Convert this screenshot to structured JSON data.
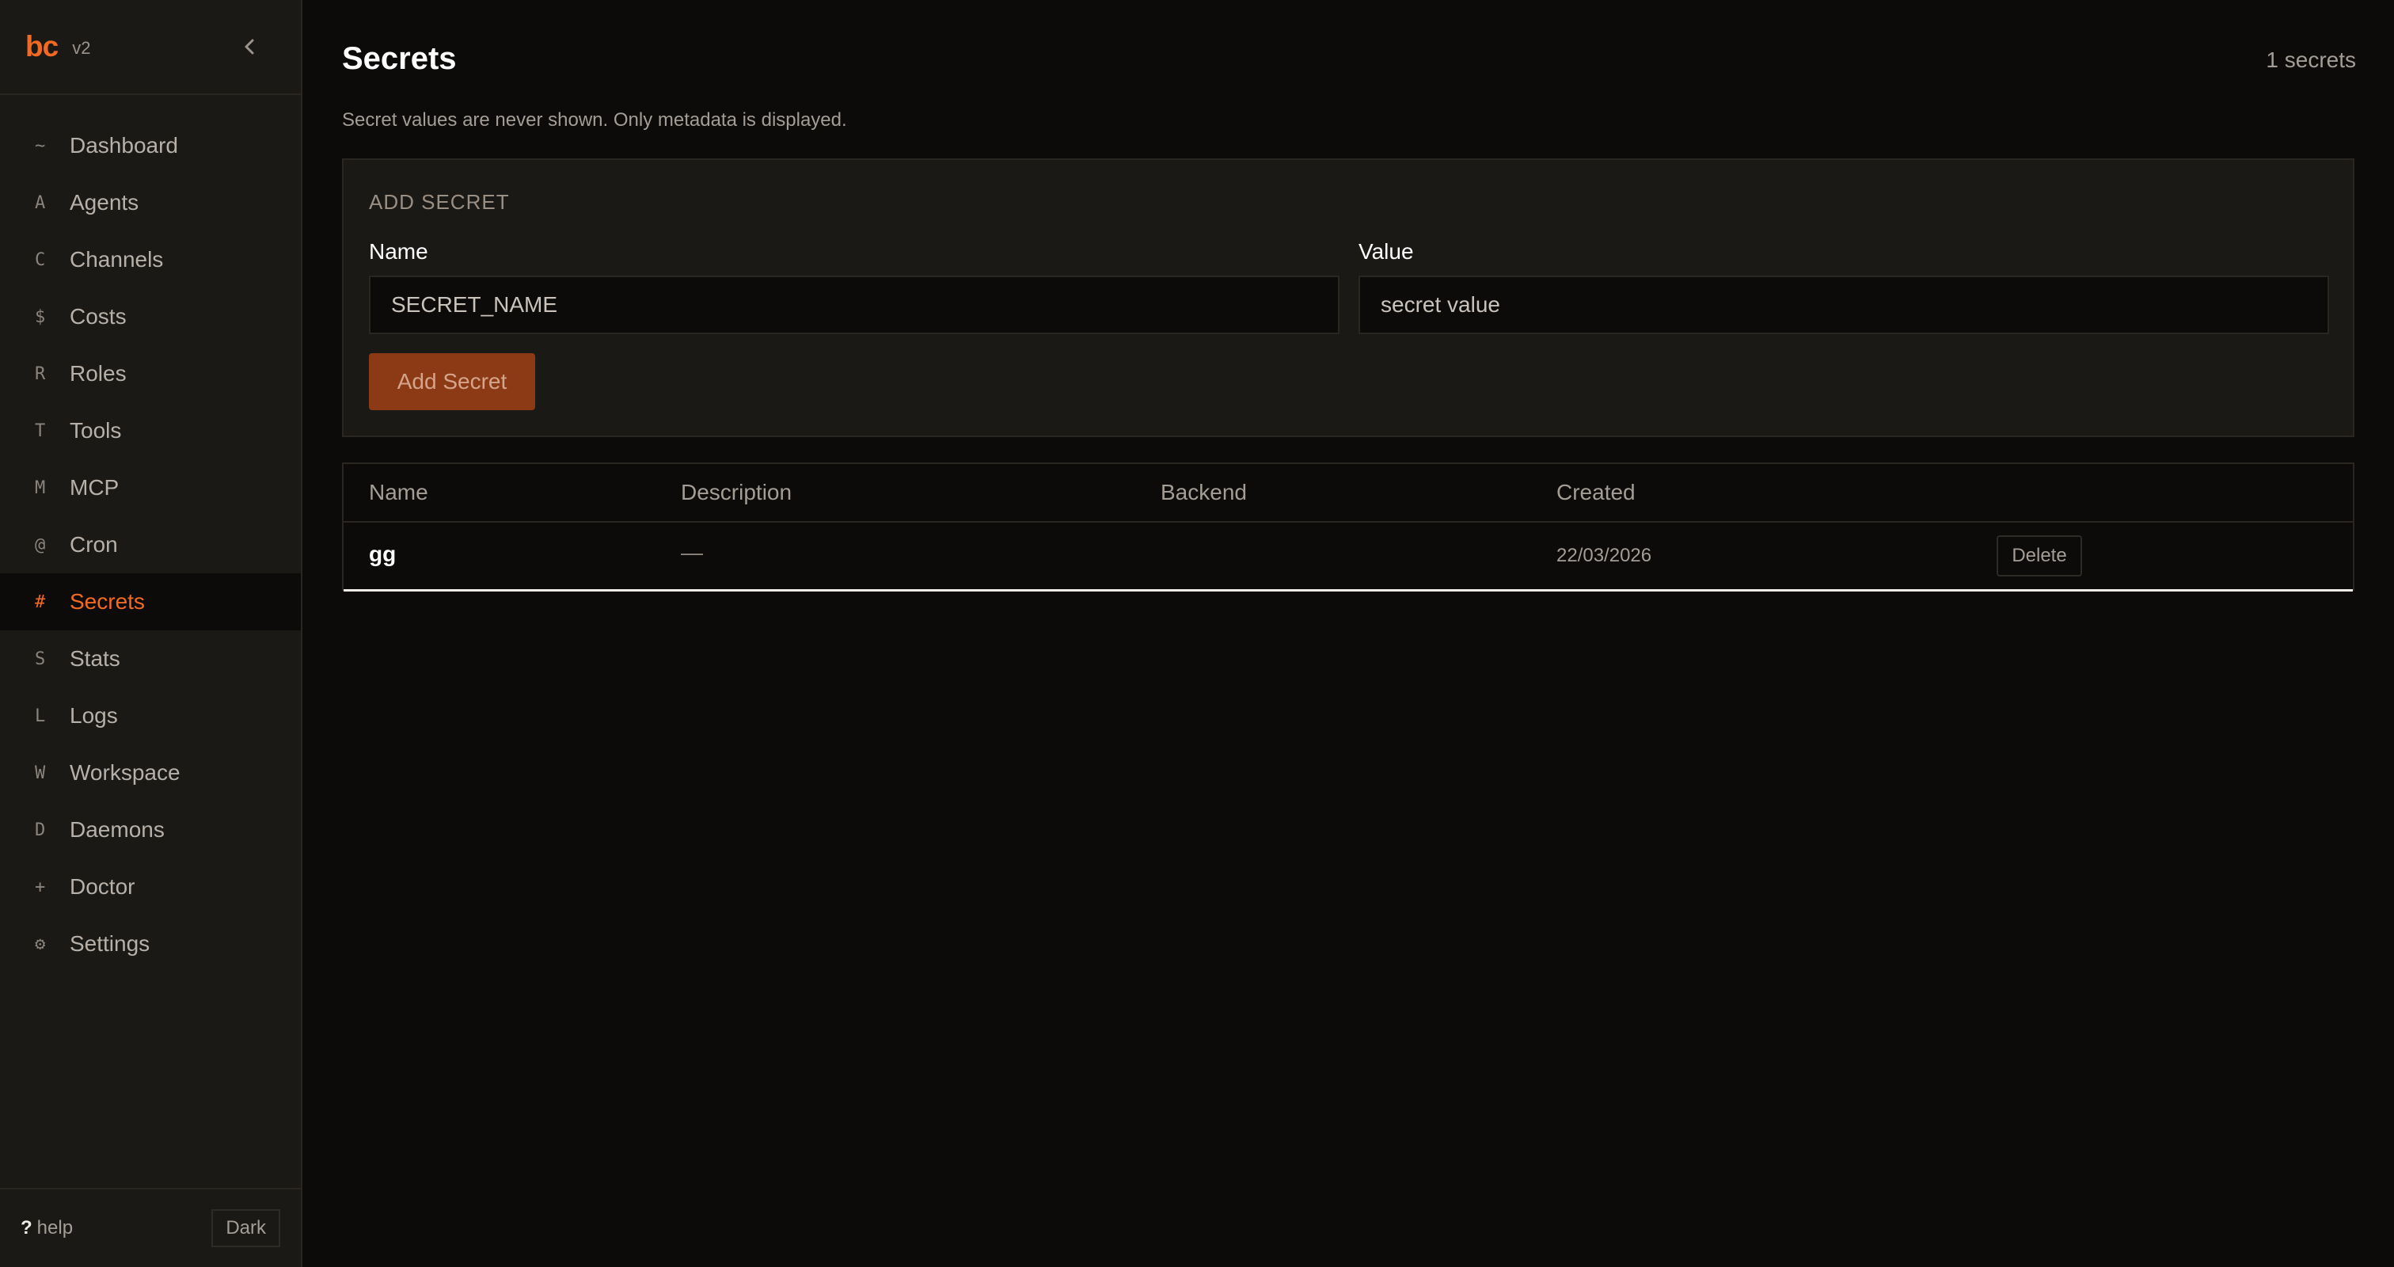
{
  "app": {
    "logo": "bc",
    "version": "v2"
  },
  "sidebar": {
    "items": [
      {
        "glyph": "~",
        "label": "Dashboard"
      },
      {
        "glyph": "A",
        "label": "Agents"
      },
      {
        "glyph": "C",
        "label": "Channels"
      },
      {
        "glyph": "$",
        "label": "Costs"
      },
      {
        "glyph": "R",
        "label": "Roles"
      },
      {
        "glyph": "T",
        "label": "Tools"
      },
      {
        "glyph": "M",
        "label": "MCP"
      },
      {
        "glyph": "@",
        "label": "Cron"
      },
      {
        "glyph": "#",
        "label": "Secrets",
        "active": true
      },
      {
        "glyph": "S",
        "label": "Stats"
      },
      {
        "glyph": "L",
        "label": "Logs"
      },
      {
        "glyph": "W",
        "label": "Workspace"
      },
      {
        "glyph": "D",
        "label": "Daemons"
      },
      {
        "glyph": "+",
        "label": "Doctor"
      },
      {
        "glyph": "⚙",
        "label": "Settings"
      }
    ],
    "footer": {
      "help_icon": "?",
      "help_label": "help",
      "theme_label": "Dark"
    }
  },
  "page": {
    "title": "Secrets",
    "count": "1 secrets",
    "subtitle": "Secret values are never shown. Only metadata is displayed."
  },
  "add_form": {
    "heading": "ADD SECRET",
    "name_label": "Name",
    "name_placeholder": "SECRET_NAME",
    "value_label": "Value",
    "value_placeholder": "secret value",
    "submit_label": "Add Secret"
  },
  "table": {
    "headers": [
      "Name",
      "Description",
      "Backend",
      "Created"
    ],
    "rows": [
      {
        "name": "gg",
        "description": "—",
        "backend": "",
        "created": "22/03/2026",
        "action": "Delete"
      }
    ]
  },
  "colors": {
    "accent": "#f26a21",
    "button": "#8c3a15",
    "background": "#0c0b0a",
    "panel": "#1b1916"
  }
}
